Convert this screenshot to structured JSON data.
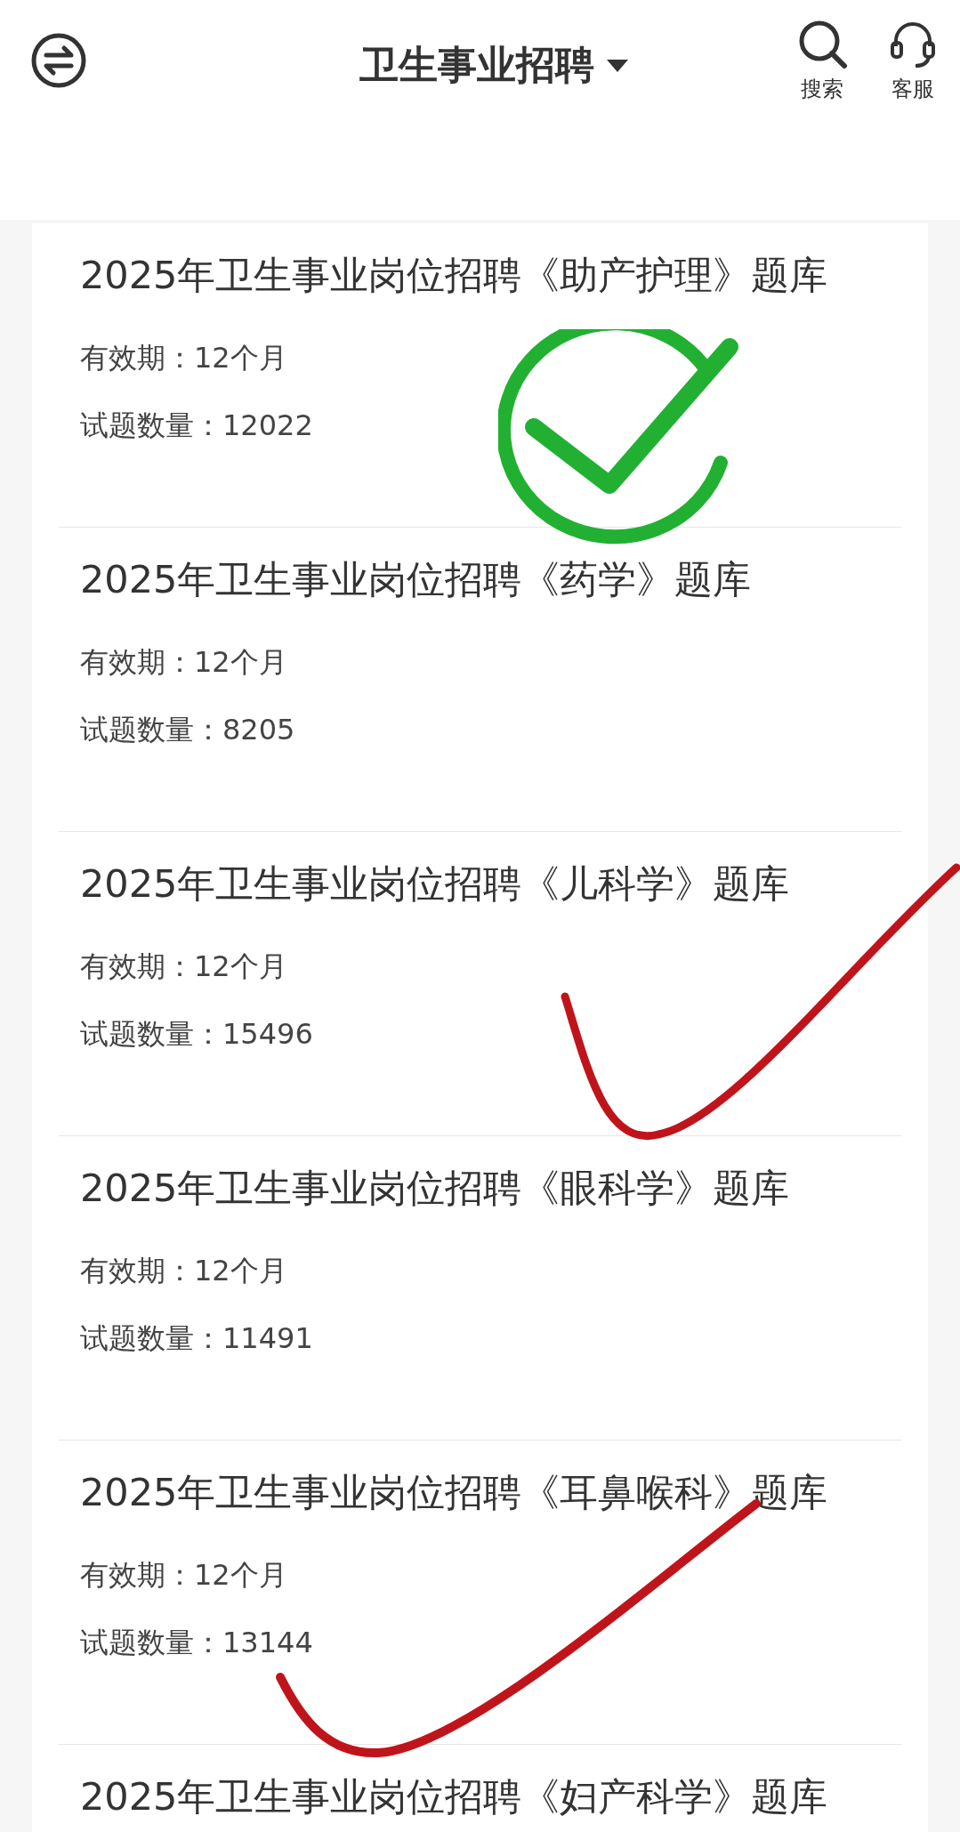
{
  "header": {
    "title": "卫生事业招聘",
    "actions": [
      {
        "kind": "search",
        "label": "搜索"
      },
      {
        "kind": "service",
        "label": "客服"
      }
    ]
  },
  "courses": [
    {
      "title": "2025年卫生事业岗位招聘《助产护理》题库",
      "validity": "有效期：12个月",
      "count": "试题数量：12022"
    },
    {
      "title": "2025年卫生事业岗位招聘《药学》题库",
      "validity": "有效期：12个月",
      "count": "试题数量：8205"
    },
    {
      "title": "2025年卫生事业岗位招聘《儿科学》题库",
      "validity": "有效期：12个月",
      "count": "试题数量：15496"
    },
    {
      "title": "2025年卫生事业岗位招聘《眼科学》题库",
      "validity": "有效期：12个月",
      "count": "试题数量：11491"
    },
    {
      "title": "2025年卫生事业岗位招聘《耳鼻喉科》题库",
      "validity": "有效期：12个月",
      "count": "试题数量：13144"
    },
    {
      "title": "2025年卫生事业岗位招聘《妇产科学》题库"
    }
  ]
}
